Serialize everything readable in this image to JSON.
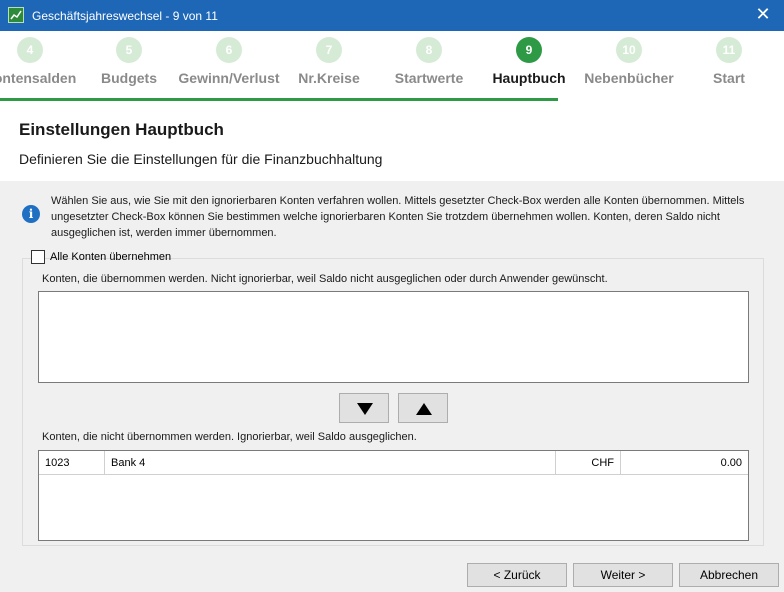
{
  "window": {
    "title": "Geschäftsjahreswechsel - 9 von 11",
    "close_glyph": "✕"
  },
  "wizard": {
    "steps": [
      {
        "number": "4",
        "label": "Kontensalden"
      },
      {
        "number": "5",
        "label": "Budgets"
      },
      {
        "number": "6",
        "label": "Gewinn/Verlust"
      },
      {
        "number": "7",
        "label": "Nr.Kreise"
      },
      {
        "number": "8",
        "label": "Startwerte"
      },
      {
        "number": "9",
        "label": "Hauptbuch"
      },
      {
        "number": "10",
        "label": "Nebenbücher"
      },
      {
        "number": "11",
        "label": "Start"
      }
    ],
    "active_step": "9"
  },
  "header": {
    "title": "Einstellungen Hauptbuch",
    "subtitle": "Definieren Sie die Einstellungen für die Finanzbuchhaltung"
  },
  "info": {
    "icon": "info-icon",
    "text": "Wählen Sie aus, wie Sie mit den ignorierbaren Konten verfahren wollen. Mittels gesetzter Check-Box werden alle Konten übernommen. Mittels ungesetzter Check-Box können Sie bestimmen welche ignorierbaren Konten Sie trotzdem übernehmen wollen. Konten, deren Saldo nicht ausgeglichen ist, werden immer übernommen."
  },
  "group": {
    "checkbox_label": "Alle Konten übernehmen",
    "checkbox_checked": false,
    "transferred_label": "Konten, die übernommen werden. Nicht ignorierbar, weil Saldo nicht ausgeglichen oder durch Anwender gewünscht.",
    "not_transferred_label": "Konten, die nicht übernommen werden. Ignorierbar, weil Saldo ausgeglichen.",
    "move_down_icon": "arrow-down-icon",
    "move_up_icon": "arrow-up-icon",
    "not_transferred_rows": [
      {
        "number": "1023",
        "name": "Bank 4",
        "currency": "CHF",
        "balance": "0.00"
      }
    ]
  },
  "footer": {
    "back": "< Zurück",
    "next": "Weiter >",
    "cancel": "Abbrechen"
  },
  "colors": {
    "titlebar": "#1e66b6",
    "accent_green": "#2e9a45",
    "step_inactive": "#d6ebd6"
  }
}
